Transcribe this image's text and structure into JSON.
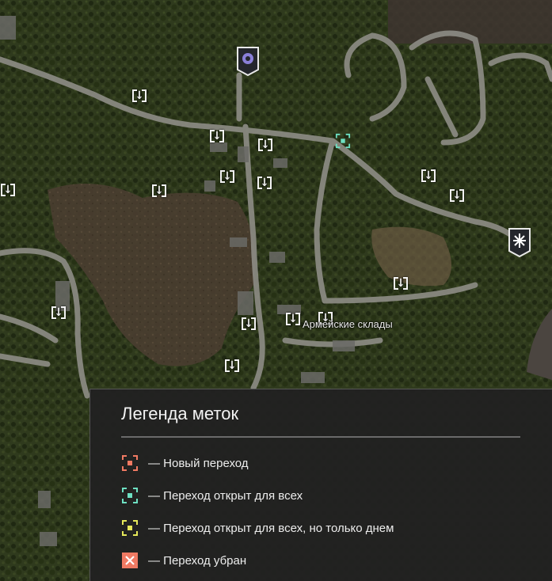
{
  "map": {
    "place_label": "Армейские склады"
  },
  "legend": {
    "title": "Легенда меток",
    "items": [
      {
        "label": "— Новый переход",
        "icon": "new-transition-icon",
        "color": "#f07a63"
      },
      {
        "label": "— Переход открыт для всех",
        "icon": "open-transition-icon",
        "color": "#6ee0c2"
      },
      {
        "label": "— Переход открыт для всех, но только днем",
        "icon": "day-only-transition-icon",
        "color": "#e6e85a"
      },
      {
        "label": "— Переход убран",
        "icon": "removed-transition-icon",
        "color": "#f07a63"
      }
    ]
  },
  "colors": {
    "open_transition": "#6ee0c2",
    "legend_bg": "#212121"
  }
}
